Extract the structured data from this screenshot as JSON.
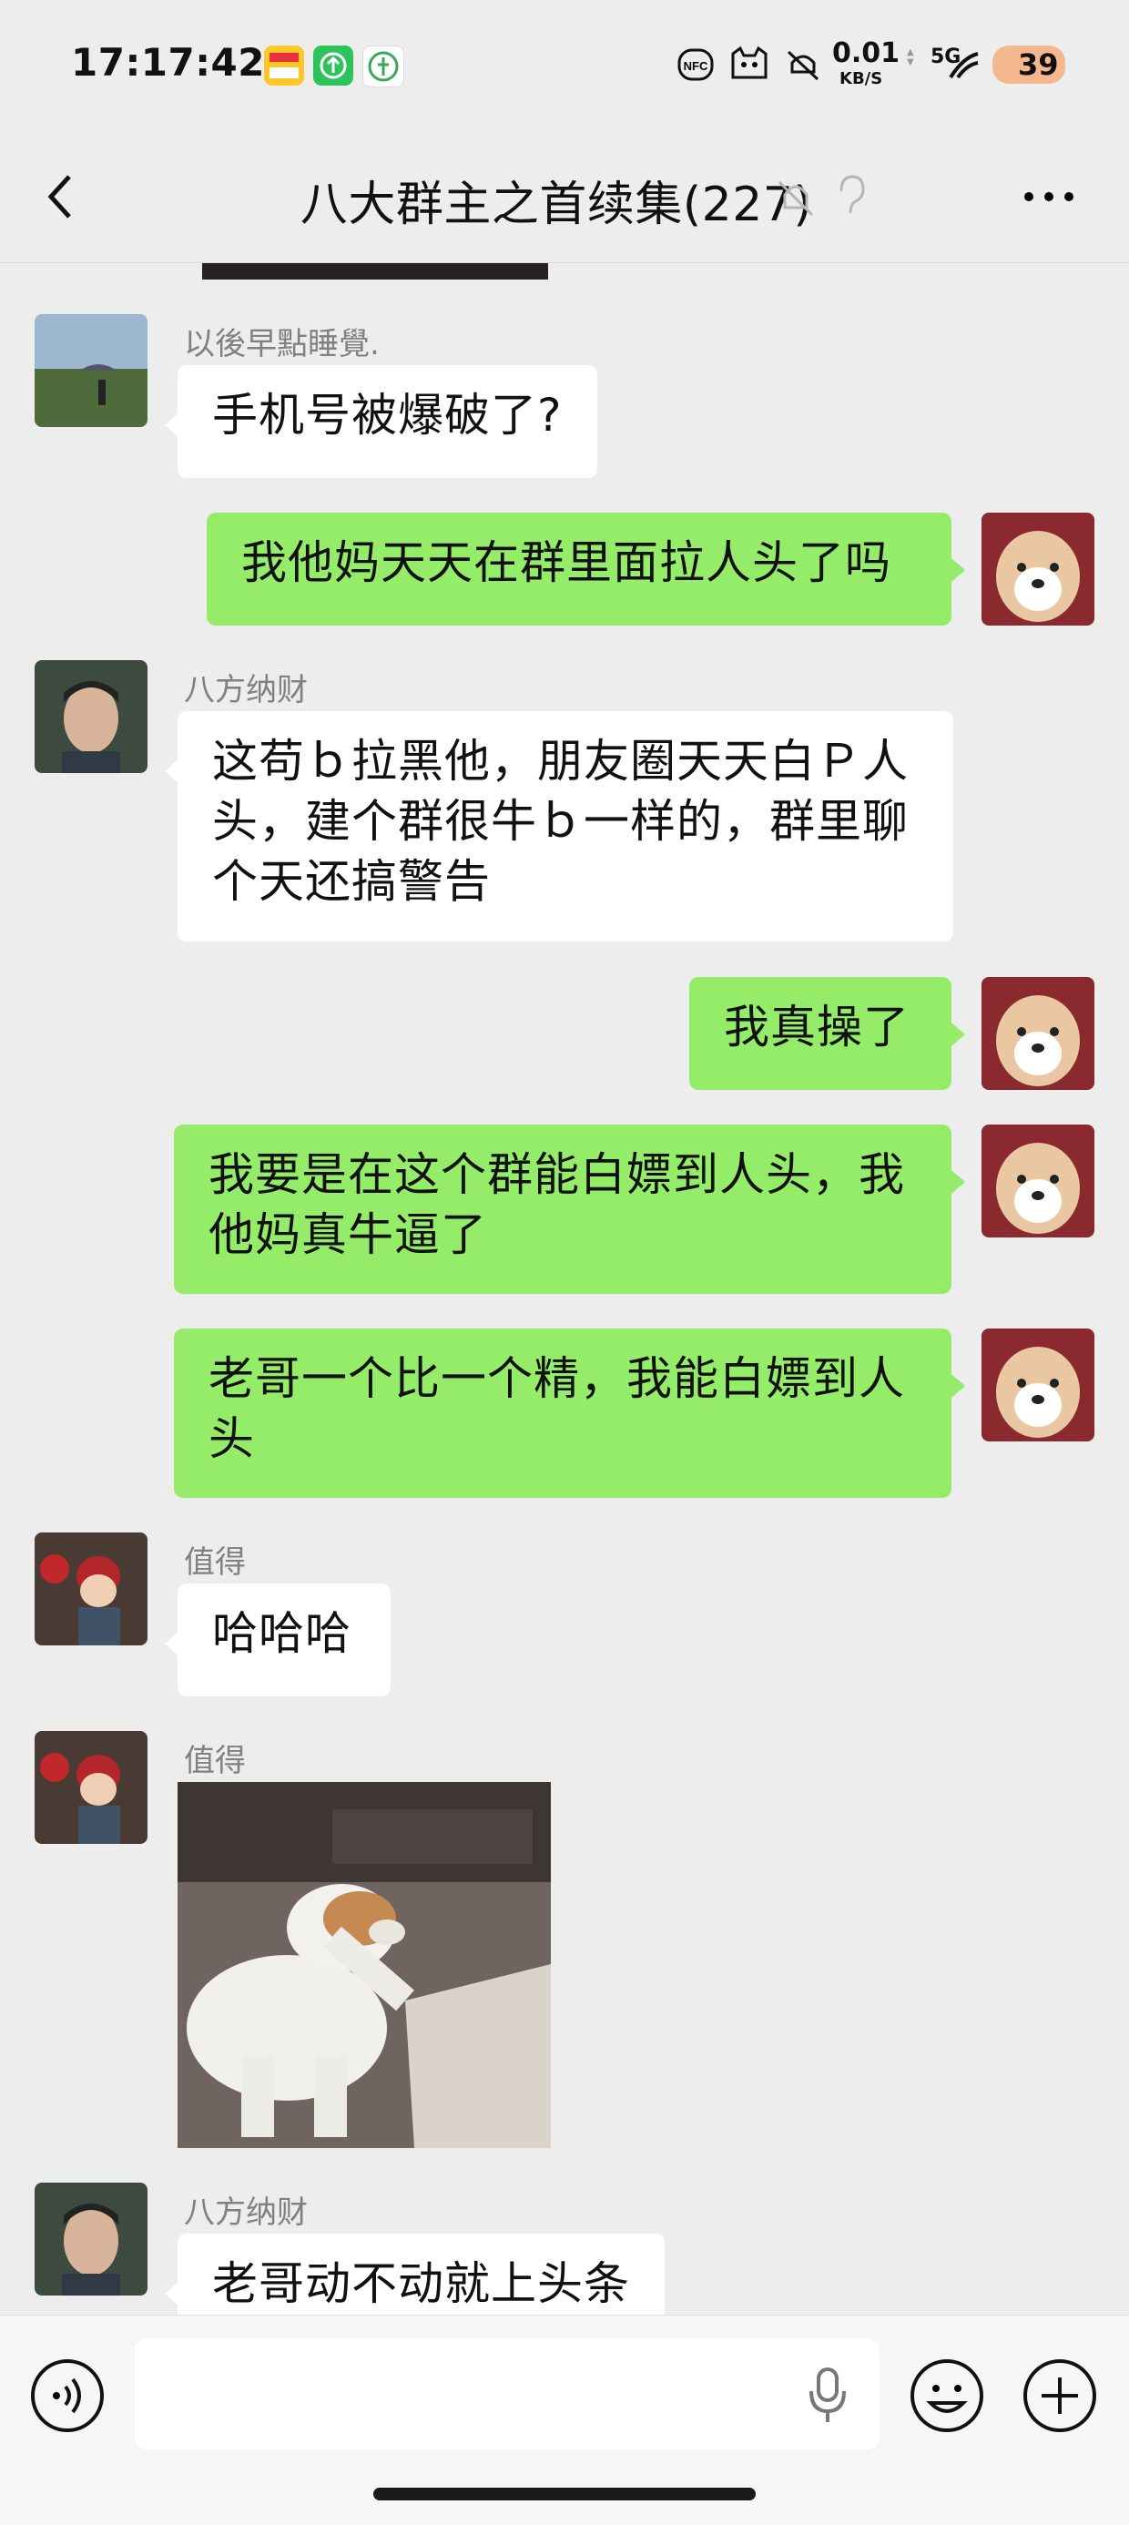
{
  "status_bar": {
    "time": "17:17:42",
    "net_speed": "0.01",
    "net_unit": "KB/S",
    "net_type": "5G",
    "battery": "39",
    "icons": [
      "app-badge-icon",
      "green-app-icon",
      "wechat-pay-icon",
      "nfc-icon",
      "cat-icon",
      "mute-icon",
      "signal-icon",
      "battery-icon"
    ]
  },
  "header": {
    "title": "八大群主之首续集(227)",
    "back_icon": "chevron-left-icon",
    "mute_icon": "bell-off-icon",
    "ear_icon": "ear-icon",
    "more_icon": "more-dots-icon"
  },
  "messages": [
    {
      "type": "incoming",
      "sender": "以後早點睡覺.",
      "text": "手机号被爆破了?"
    },
    {
      "type": "outgoing",
      "text": "我他妈天天在群里面拉人头了吗"
    },
    {
      "type": "incoming",
      "sender": "八方纳财",
      "lines": [
        "这苟ｂ拉黑他，朋友圈天天白Ｐ人",
        "头，建个群很牛ｂ一样的，群里聊",
        "个天还搞警告"
      ]
    },
    {
      "type": "outgoing",
      "text": "我真操了"
    },
    {
      "type": "outgoing",
      "lines": [
        "我要是在这个群能白嫖到人头，我",
        "他妈真牛逼了"
      ]
    },
    {
      "type": "outgoing",
      "lines": [
        "老哥一个比一个精，我能白嫖到人",
        "头"
      ]
    },
    {
      "type": "incoming",
      "sender": "值得",
      "text": "哈哈哈"
    },
    {
      "type": "incoming-image",
      "sender": "值得"
    },
    {
      "type": "incoming",
      "sender": "八方纳财",
      "text": "老哥动不动就上头条"
    }
  ],
  "input_bar": {
    "voice_icon": "voice-toggle-icon",
    "mic_icon": "microphone-icon",
    "emoji_icon": "emoji-icon",
    "plus_icon": "plus-icon",
    "placeholder": ""
  },
  "colors": {
    "background": "#ededed",
    "outgoing_bubble": "#95ec69",
    "incoming_bubble": "#ffffff",
    "sender_name": "#808080"
  }
}
